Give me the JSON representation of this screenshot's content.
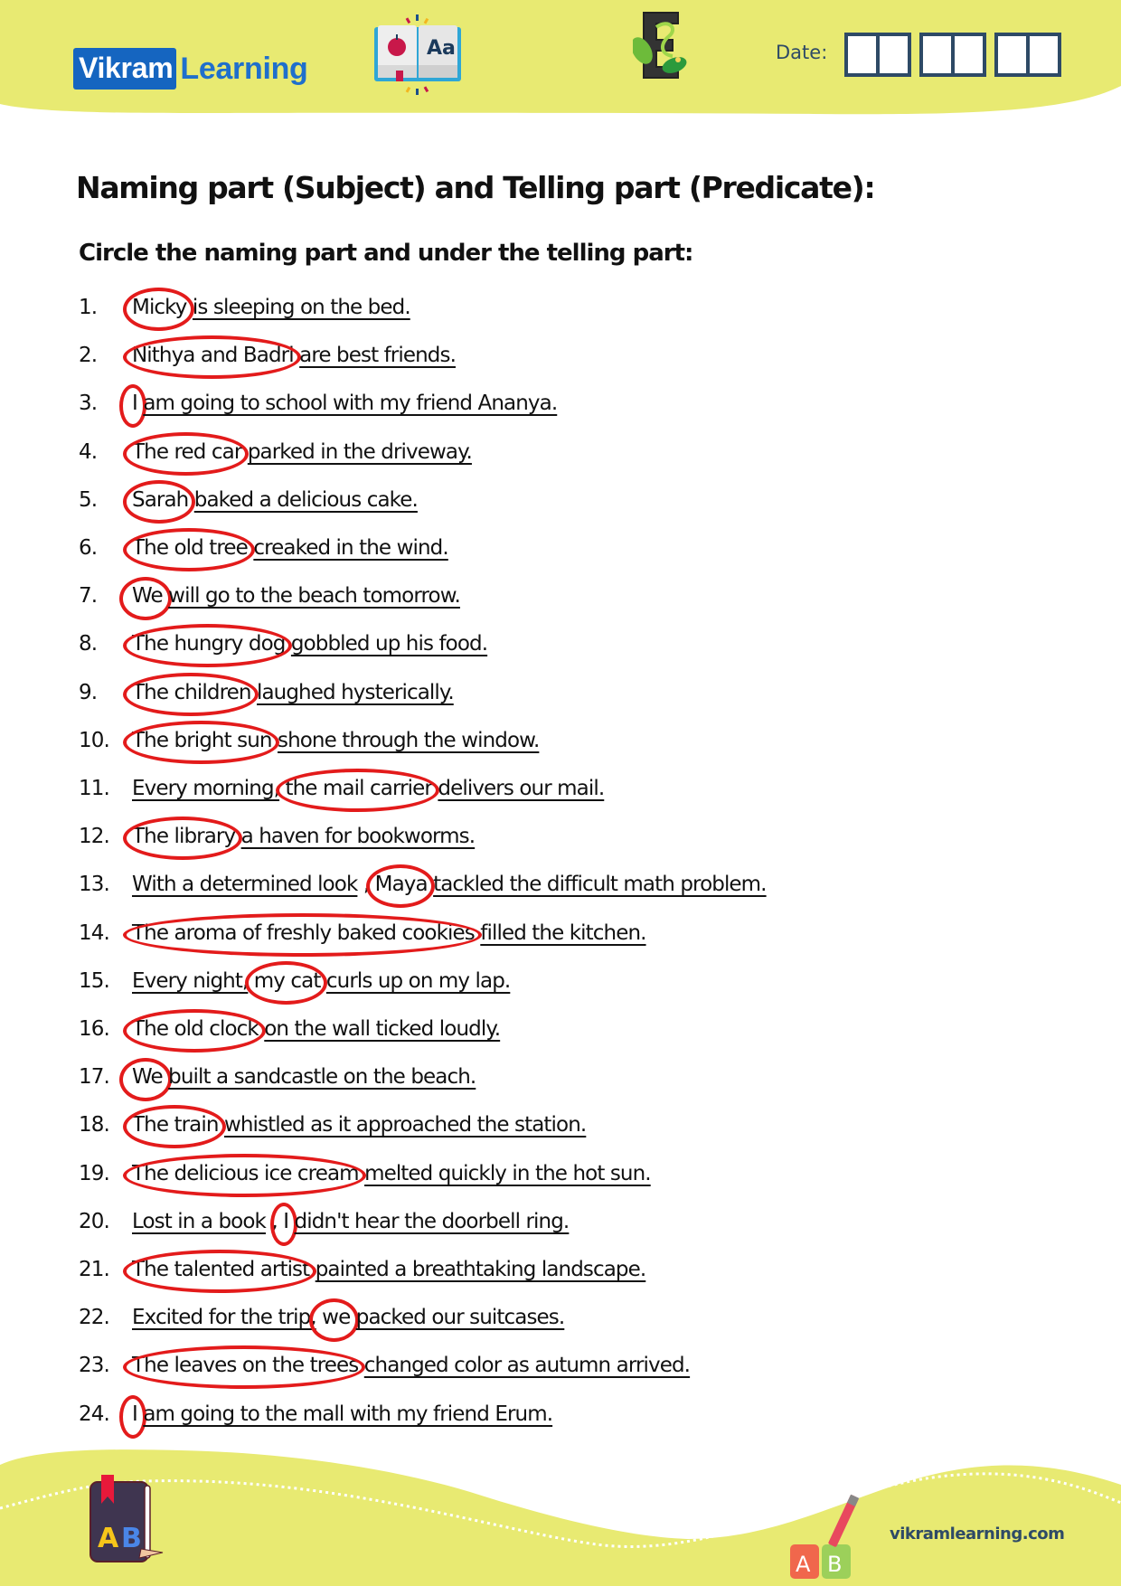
{
  "header": {
    "logo_part1": "Vikram",
    "logo_part2": "Learning",
    "date_label": "Date:",
    "date_boxes": [
      [
        "",
        ""
      ],
      [
        "",
        ""
      ],
      [
        "",
        ""
      ]
    ]
  },
  "worksheet": {
    "title": "Naming part (Subject) and Telling part (Predicate):",
    "instruction": "Circle the naming part and under the telling part:",
    "colors": {
      "circle": "#e31b1b",
      "band": "#e8ea72",
      "brand_blue": "#1565c0",
      "date_box": "#2e4a66"
    },
    "sentences": [
      {
        "num": "1.",
        "segments": [
          {
            "t": "Micky",
            "mark": "circle"
          },
          {
            "t": " ",
            "mark": ""
          },
          {
            "t": "is sleeping on the bed.",
            "mark": "underline"
          }
        ]
      },
      {
        "num": "2.",
        "segments": [
          {
            "t": "Nithya and Badri",
            "mark": "circle"
          },
          {
            "t": " ",
            "mark": ""
          },
          {
            "t": "are best friends.",
            "mark": "underline"
          }
        ]
      },
      {
        "num": "3.",
        "segments": [
          {
            "t": "I",
            "mark": "circle"
          },
          {
            "t": " ",
            "mark": ""
          },
          {
            "t": "am going to school with my friend Ananya.",
            "mark": "underline"
          }
        ]
      },
      {
        "num": "4.",
        "segments": [
          {
            "t": "The red car",
            "mark": "circle"
          },
          {
            "t": " ",
            "mark": ""
          },
          {
            "t": "parked in the driveway.",
            "mark": "underline"
          }
        ]
      },
      {
        "num": "5.",
        "segments": [
          {
            "t": "Sarah",
            "mark": "circle"
          },
          {
            "t": " ",
            "mark": ""
          },
          {
            "t": "baked a delicious cake.",
            "mark": "underline"
          }
        ]
      },
      {
        "num": "6.",
        "segments": [
          {
            "t": "The old tree",
            "mark": "circle"
          },
          {
            "t": " ",
            "mark": ""
          },
          {
            "t": "creaked in the wind.",
            "mark": "underline"
          }
        ]
      },
      {
        "num": "7.",
        "segments": [
          {
            "t": "We",
            "mark": "circle"
          },
          {
            "t": " ",
            "mark": ""
          },
          {
            "t": "will go to the beach tomorrow.",
            "mark": "underline"
          }
        ]
      },
      {
        "num": "8.",
        "segments": [
          {
            "t": "The hungry dog",
            "mark": "circle"
          },
          {
            "t": " ",
            "mark": ""
          },
          {
            "t": "gobbled up his food.",
            "mark": "underline"
          }
        ]
      },
      {
        "num": "9.",
        "segments": [
          {
            "t": "The children",
            "mark": "circle"
          },
          {
            "t": " ",
            "mark": ""
          },
          {
            "t": "laughed hysterically.",
            "mark": "underline"
          }
        ]
      },
      {
        "num": "10.",
        "segments": [
          {
            "t": "The bright sun",
            "mark": "circle"
          },
          {
            "t": " ",
            "mark": ""
          },
          {
            "t": "shone through the window.",
            "mark": "underline"
          }
        ]
      },
      {
        "num": "11.",
        "segments": [
          {
            "t": "Every morning,",
            "mark": "underline"
          },
          {
            "t": " ",
            "mark": ""
          },
          {
            "t": "the mail carrier",
            "mark": "circle"
          },
          {
            "t": " ",
            "mark": ""
          },
          {
            "t": "delivers our mail.",
            "mark": "underline"
          }
        ]
      },
      {
        "num": "12.",
        "segments": [
          {
            "t": "The library",
            "mark": "circle"
          },
          {
            "t": " ",
            "mark": ""
          },
          {
            "t": "a haven for bookworms.",
            "mark": "underline"
          }
        ]
      },
      {
        "num": "13.",
        "segments": [
          {
            "t": "With a determined look",
            "mark": "underline"
          },
          {
            "t": " , ",
            "mark": ""
          },
          {
            "t": "Maya",
            "mark": "circle"
          },
          {
            "t": " ",
            "mark": ""
          },
          {
            "t": "tackled the difficult math problem.",
            "mark": "underline"
          }
        ]
      },
      {
        "num": "14.",
        "segments": [
          {
            "t": "The aroma of freshly baked cookies",
            "mark": "circle"
          },
          {
            "t": " ",
            "mark": ""
          },
          {
            "t": "filled the kitchen.",
            "mark": "underline"
          }
        ]
      },
      {
        "num": "15.",
        "segments": [
          {
            "t": "Every night,",
            "mark": "underline"
          },
          {
            "t": " ",
            "mark": ""
          },
          {
            "t": "my cat",
            "mark": "circle"
          },
          {
            "t": " ",
            "mark": ""
          },
          {
            "t": "curls up on my lap.",
            "mark": "underline"
          }
        ]
      },
      {
        "num": "16.",
        "segments": [
          {
            "t": "The old clock",
            "mark": "circle"
          },
          {
            "t": " ",
            "mark": ""
          },
          {
            "t": "on the wall ticked loudly.",
            "mark": "underline"
          }
        ]
      },
      {
        "num": "17.",
        "segments": [
          {
            "t": "We",
            "mark": "circle"
          },
          {
            "t": " ",
            "mark": ""
          },
          {
            "t": "built a sandcastle on the beach.",
            "mark": "underline"
          }
        ]
      },
      {
        "num": "18.",
        "segments": [
          {
            "t": "The train",
            "mark": "circle"
          },
          {
            "t": " ",
            "mark": ""
          },
          {
            "t": "whistled as it approached the station.",
            "mark": "underline"
          }
        ]
      },
      {
        "num": "19.",
        "segments": [
          {
            "t": "The delicious ice cream",
            "mark": "circle"
          },
          {
            "t": " ",
            "mark": ""
          },
          {
            "t": "melted quickly in the hot sun.",
            "mark": "underline"
          }
        ]
      },
      {
        "num": "20.",
        "segments": [
          {
            "t": "Lost in a book",
            "mark": "underline"
          },
          {
            "t": " , ",
            "mark": ""
          },
          {
            "t": "I",
            "mark": "circle"
          },
          {
            "t": " ",
            "mark": ""
          },
          {
            "t": "didn't hear the doorbell ring.",
            "mark": "underline"
          }
        ]
      },
      {
        "num": "21.",
        "segments": [
          {
            "t": "The talented artist",
            "mark": "circle"
          },
          {
            "t": " ",
            "mark": ""
          },
          {
            "t": "painted a breathtaking landscape.",
            "mark": "underline"
          }
        ]
      },
      {
        "num": "22.",
        "segments": [
          {
            "t": "Excited for the trip,",
            "mark": "underline"
          },
          {
            "t": " ",
            "mark": ""
          },
          {
            "t": "we",
            "mark": "circle"
          },
          {
            "t": " ",
            "mark": ""
          },
          {
            "t": "packed our suitcases.",
            "mark": "underline"
          }
        ]
      },
      {
        "num": "23.",
        "segments": [
          {
            "t": "The leaves on the trees",
            "mark": "circle"
          },
          {
            "t": " ",
            "mark": ""
          },
          {
            "t": "changed color as autumn arrived.",
            "mark": "underline"
          }
        ]
      },
      {
        "num": "24.",
        "segments": [
          {
            "t": "I",
            "mark": "circle"
          },
          {
            "t": " ",
            "mark": ""
          },
          {
            "t": "am going to the mall with my friend Erum.",
            "mark": "underline"
          }
        ]
      }
    ]
  },
  "footer": {
    "url": "vikramlearning.com",
    "blocks_letters": [
      "A",
      "B"
    ],
    "book_letters": [
      "A",
      "B"
    ]
  }
}
